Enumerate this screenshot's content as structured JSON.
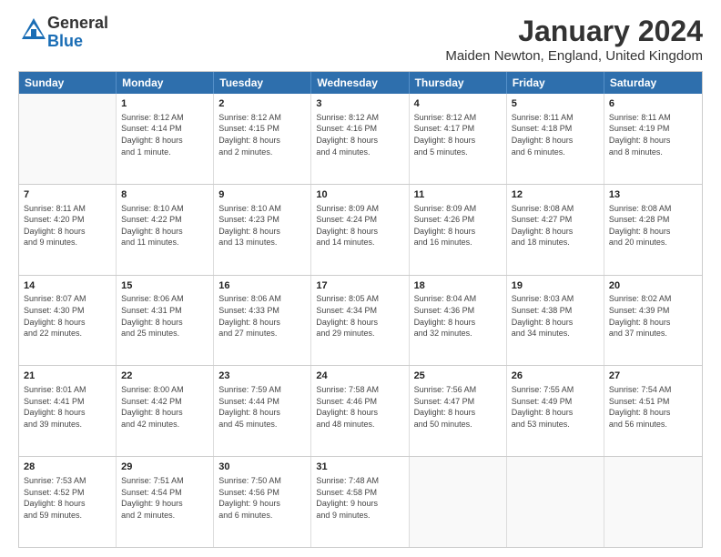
{
  "logo": {
    "general": "General",
    "blue": "Blue"
  },
  "title": "January 2024",
  "location": "Maiden Newton, England, United Kingdom",
  "header_days": [
    "Sunday",
    "Monday",
    "Tuesday",
    "Wednesday",
    "Thursday",
    "Friday",
    "Saturday"
  ],
  "weeks": [
    [
      {
        "day": "",
        "info": ""
      },
      {
        "day": "1",
        "info": "Sunrise: 8:12 AM\nSunset: 4:14 PM\nDaylight: 8 hours\nand 1 minute."
      },
      {
        "day": "2",
        "info": "Sunrise: 8:12 AM\nSunset: 4:15 PM\nDaylight: 8 hours\nand 2 minutes."
      },
      {
        "day": "3",
        "info": "Sunrise: 8:12 AM\nSunset: 4:16 PM\nDaylight: 8 hours\nand 4 minutes."
      },
      {
        "day": "4",
        "info": "Sunrise: 8:12 AM\nSunset: 4:17 PM\nDaylight: 8 hours\nand 5 minutes."
      },
      {
        "day": "5",
        "info": "Sunrise: 8:11 AM\nSunset: 4:18 PM\nDaylight: 8 hours\nand 6 minutes."
      },
      {
        "day": "6",
        "info": "Sunrise: 8:11 AM\nSunset: 4:19 PM\nDaylight: 8 hours\nand 8 minutes."
      }
    ],
    [
      {
        "day": "7",
        "info": "Sunrise: 8:11 AM\nSunset: 4:20 PM\nDaylight: 8 hours\nand 9 minutes."
      },
      {
        "day": "8",
        "info": "Sunrise: 8:10 AM\nSunset: 4:22 PM\nDaylight: 8 hours\nand 11 minutes."
      },
      {
        "day": "9",
        "info": "Sunrise: 8:10 AM\nSunset: 4:23 PM\nDaylight: 8 hours\nand 13 minutes."
      },
      {
        "day": "10",
        "info": "Sunrise: 8:09 AM\nSunset: 4:24 PM\nDaylight: 8 hours\nand 14 minutes."
      },
      {
        "day": "11",
        "info": "Sunrise: 8:09 AM\nSunset: 4:26 PM\nDaylight: 8 hours\nand 16 minutes."
      },
      {
        "day": "12",
        "info": "Sunrise: 8:08 AM\nSunset: 4:27 PM\nDaylight: 8 hours\nand 18 minutes."
      },
      {
        "day": "13",
        "info": "Sunrise: 8:08 AM\nSunset: 4:28 PM\nDaylight: 8 hours\nand 20 minutes."
      }
    ],
    [
      {
        "day": "14",
        "info": "Sunrise: 8:07 AM\nSunset: 4:30 PM\nDaylight: 8 hours\nand 22 minutes."
      },
      {
        "day": "15",
        "info": "Sunrise: 8:06 AM\nSunset: 4:31 PM\nDaylight: 8 hours\nand 25 minutes."
      },
      {
        "day": "16",
        "info": "Sunrise: 8:06 AM\nSunset: 4:33 PM\nDaylight: 8 hours\nand 27 minutes."
      },
      {
        "day": "17",
        "info": "Sunrise: 8:05 AM\nSunset: 4:34 PM\nDaylight: 8 hours\nand 29 minutes."
      },
      {
        "day": "18",
        "info": "Sunrise: 8:04 AM\nSunset: 4:36 PM\nDaylight: 8 hours\nand 32 minutes."
      },
      {
        "day": "19",
        "info": "Sunrise: 8:03 AM\nSunset: 4:38 PM\nDaylight: 8 hours\nand 34 minutes."
      },
      {
        "day": "20",
        "info": "Sunrise: 8:02 AM\nSunset: 4:39 PM\nDaylight: 8 hours\nand 37 minutes."
      }
    ],
    [
      {
        "day": "21",
        "info": "Sunrise: 8:01 AM\nSunset: 4:41 PM\nDaylight: 8 hours\nand 39 minutes."
      },
      {
        "day": "22",
        "info": "Sunrise: 8:00 AM\nSunset: 4:42 PM\nDaylight: 8 hours\nand 42 minutes."
      },
      {
        "day": "23",
        "info": "Sunrise: 7:59 AM\nSunset: 4:44 PM\nDaylight: 8 hours\nand 45 minutes."
      },
      {
        "day": "24",
        "info": "Sunrise: 7:58 AM\nSunset: 4:46 PM\nDaylight: 8 hours\nand 48 minutes."
      },
      {
        "day": "25",
        "info": "Sunrise: 7:56 AM\nSunset: 4:47 PM\nDaylight: 8 hours\nand 50 minutes."
      },
      {
        "day": "26",
        "info": "Sunrise: 7:55 AM\nSunset: 4:49 PM\nDaylight: 8 hours\nand 53 minutes."
      },
      {
        "day": "27",
        "info": "Sunrise: 7:54 AM\nSunset: 4:51 PM\nDaylight: 8 hours\nand 56 minutes."
      }
    ],
    [
      {
        "day": "28",
        "info": "Sunrise: 7:53 AM\nSunset: 4:52 PM\nDaylight: 8 hours\nand 59 minutes."
      },
      {
        "day": "29",
        "info": "Sunrise: 7:51 AM\nSunset: 4:54 PM\nDaylight: 9 hours\nand 2 minutes."
      },
      {
        "day": "30",
        "info": "Sunrise: 7:50 AM\nSunset: 4:56 PM\nDaylight: 9 hours\nand 6 minutes."
      },
      {
        "day": "31",
        "info": "Sunrise: 7:48 AM\nSunset: 4:58 PM\nDaylight: 9 hours\nand 9 minutes."
      },
      {
        "day": "",
        "info": ""
      },
      {
        "day": "",
        "info": ""
      },
      {
        "day": "",
        "info": ""
      }
    ]
  ]
}
